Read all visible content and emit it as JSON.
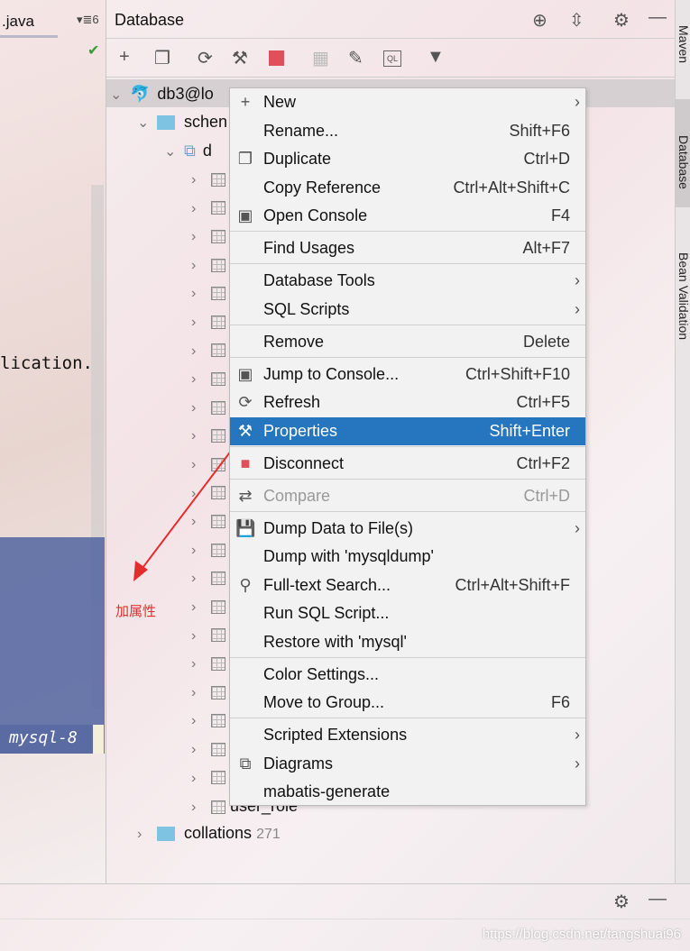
{
  "editor": {
    "tab": ".java",
    "tab_count": "6",
    "code_line": "lication.",
    "mysql_label": "mysql-8"
  },
  "db_panel": {
    "title": "Database",
    "connection": "db3@lo",
    "schemas": "schen",
    "schema": "d",
    "tables_last": "user_role",
    "collations": "collations",
    "collations_count": "271"
  },
  "right_tabs": [
    "Maven",
    "Database",
    "Bean Validation"
  ],
  "menu": {
    "items": [
      {
        "icon": "plus-icon",
        "label": "New",
        "shortcut": "",
        "submenu": true
      },
      {
        "icon": "",
        "label": "Rename...",
        "shortcut": "Shift+F6"
      },
      {
        "icon": "duplicate-icon",
        "label": "Duplicate",
        "shortcut": "Ctrl+D"
      },
      {
        "icon": "",
        "label": "Copy Reference",
        "shortcut": "Ctrl+Alt+Shift+C"
      },
      {
        "icon": "console-icon",
        "label": "Open Console",
        "shortcut": "F4"
      },
      {
        "icon": "",
        "label": "Find Usages",
        "shortcut": "Alt+F7"
      },
      {
        "icon": "",
        "label": "Database Tools",
        "shortcut": "",
        "submenu": true
      },
      {
        "icon": "",
        "label": "SQL Scripts",
        "shortcut": "",
        "submenu": true
      },
      {
        "icon": "",
        "label": "Remove",
        "shortcut": "Delete"
      },
      {
        "icon": "console-icon",
        "label": "Jump to Console...",
        "shortcut": "Ctrl+Shift+F10"
      },
      {
        "icon": "refresh-icon",
        "label": "Refresh",
        "shortcut": "Ctrl+F5"
      },
      {
        "icon": "properties-icon",
        "label": "Properties",
        "shortcut": "Shift+Enter",
        "selected": true
      },
      {
        "icon": "stop-icon",
        "label": "Disconnect",
        "shortcut": "Ctrl+F2"
      },
      {
        "icon": "compare-icon",
        "label": "Compare",
        "shortcut": "Ctrl+D",
        "disabled": true
      },
      {
        "icon": "save-icon",
        "label": "Dump Data to File(s)",
        "shortcut": "",
        "submenu": true
      },
      {
        "icon": "",
        "label": "Dump with 'mysqldump'",
        "shortcut": ""
      },
      {
        "icon": "search-icon",
        "label": "Full-text Search...",
        "shortcut": "Ctrl+Alt+Shift+F"
      },
      {
        "icon": "",
        "label": "Run SQL Script...",
        "shortcut": ""
      },
      {
        "icon": "",
        "label": "Restore with 'mysql'",
        "shortcut": ""
      },
      {
        "icon": "",
        "label": "Color Settings...",
        "shortcut": ""
      },
      {
        "icon": "",
        "label": "Move to Group...",
        "shortcut": "F6"
      },
      {
        "icon": "",
        "label": "Scripted Extensions",
        "shortcut": "",
        "submenu": true
      },
      {
        "icon": "diagram-icon",
        "label": "Diagrams",
        "shortcut": "",
        "submenu": true
      },
      {
        "icon": "",
        "label": "mabatis-generate",
        "shortcut": ""
      }
    ]
  },
  "annotation": "加属性",
  "watermark": "https://blog.csdn.net/tangshuai96",
  "colors": {
    "selection": "#2675bf",
    "annotation": "#e52c2c",
    "stop": "#e0505a"
  }
}
